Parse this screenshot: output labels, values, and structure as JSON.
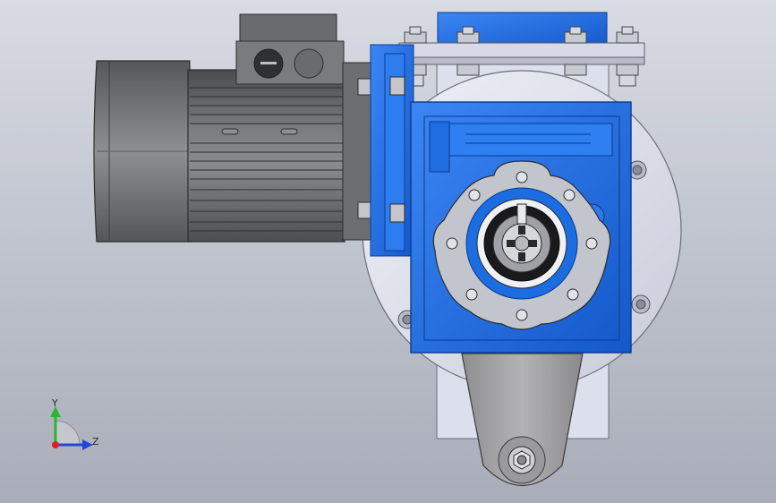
{
  "viewport": {
    "background_top": "#d9dbe3",
    "background_bottom": "#a9adb9"
  },
  "model": {
    "motor_color": "#6e6f71",
    "gearbox_color": "#1f6fe8",
    "flange_color": "#dfe2ee",
    "arm_color": "#a7a7a9"
  },
  "triad": {
    "y_label": "Y",
    "z_label": "Z",
    "y_color": "#2db52d",
    "z_color": "#2247d6",
    "x_color": "#e02020"
  }
}
